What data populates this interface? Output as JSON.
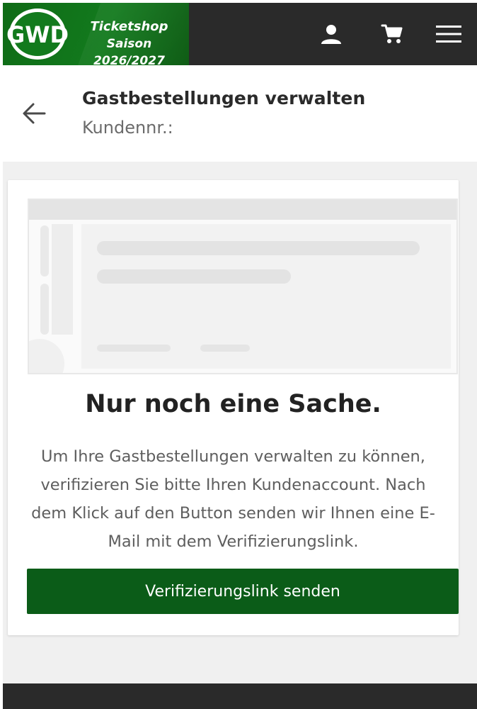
{
  "header": {
    "brand_line1": "Ticketshop",
    "brand_line2": "Saison 2026/2027",
    "logo_text": "GWD",
    "icons": [
      "account-icon",
      "cart-icon",
      "menu-icon"
    ],
    "colors": {
      "bar": "#2a2a2a",
      "brand_green": "#127a1d"
    }
  },
  "page": {
    "title": "Gastbestellungen verwalten",
    "subtitle": "Kundennr.:",
    "back_icon": "arrow-left-icon"
  },
  "card": {
    "headline": "Nur noch eine Sache.",
    "description": "Um Ihre Gastbestellungen verwalten zu können, verifizieren Sie bitte Ihren Kundenaccount. Nach dem Klick auf den Button senden wir Ihnen eine E-Mail mit dem Verifizierungslink.",
    "button_label": "Verifizierungslink senden",
    "button_color": "#0b5c18"
  }
}
